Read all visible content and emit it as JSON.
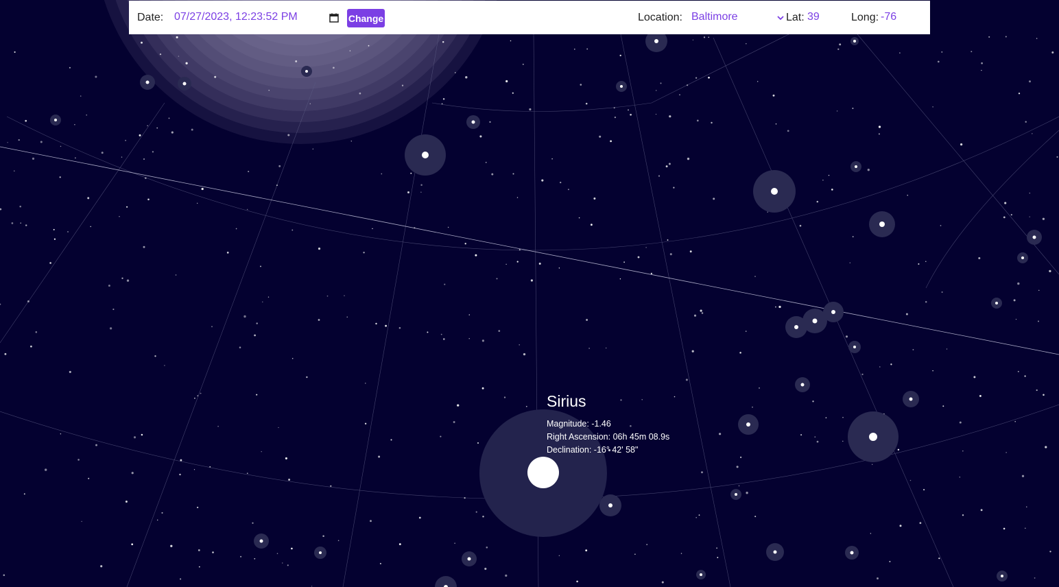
{
  "toolbar": {
    "date_label": "Date:",
    "date_value": "07/27/2023, 12:23:52 PM",
    "change_label": "Change",
    "location_label": "Location:",
    "location_value": "Baltimore",
    "lat_label": "Lat:",
    "lat_value": "39",
    "long_label": "Long:",
    "long_value": "-76",
    "accent_color": "#7b3fe4",
    "icons": [
      "calendar-icon",
      "chevron-down-icon"
    ]
  },
  "selected_star": {
    "name": "Sirius",
    "magnitude_text": "Magnitude: -1.46",
    "right_ascension_text": "Right Ascension: 06h 45m 08.9s",
    "declination_text": "Declination: -16° 42' 58\""
  },
  "sky": {
    "background_color": "#040130",
    "star_color": "#ffffff",
    "halo_color": "#2a2a52",
    "moon_glow_color": "#8f88b0"
  }
}
